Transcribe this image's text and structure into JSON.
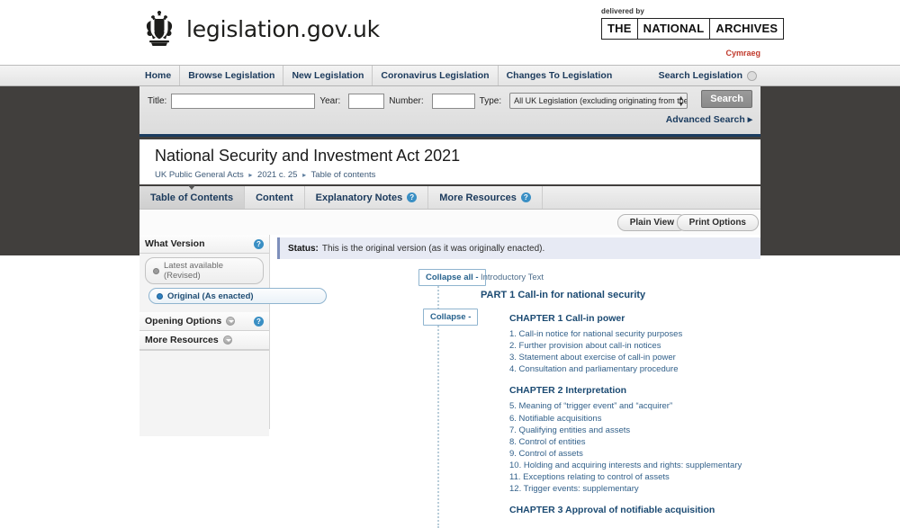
{
  "masthead": {
    "brand": "legislation.gov.uk",
    "delivered_by": "delivered by",
    "archives": [
      "THE",
      "NATIONAL",
      "ARCHIVES"
    ],
    "language_link": "Cymraeg"
  },
  "nav": {
    "items": [
      "Home",
      "Browse Legislation",
      "New Legislation",
      "Coronavirus Legislation",
      "Changes To Legislation"
    ],
    "search_link": "Search Legislation"
  },
  "search": {
    "title_label": "Title:",
    "title_value": "",
    "year_label": "Year:",
    "year_value": "",
    "number_label": "Number:",
    "number_value": "",
    "type_label": "Type:",
    "type_selected": "All UK Legislation (excluding originating from the",
    "search_button": "Search",
    "advanced_search": "Advanced Search ▸"
  },
  "page": {
    "title": "National Security and Investment Act 2021",
    "breadcrumb": [
      "UK Public General Acts",
      "2021 c. 25",
      "Table of contents"
    ]
  },
  "tabs": [
    {
      "label": "Table of Contents",
      "help": false,
      "active": true
    },
    {
      "label": "Content",
      "help": false,
      "active": false
    },
    {
      "label": "Explanatory Notes",
      "help": true,
      "active": false
    },
    {
      "label": "More Resources",
      "help": true,
      "active": false
    }
  ],
  "toolbar": {
    "plain_view": "Plain View",
    "print_options": "Print Options"
  },
  "sidebar": {
    "what_version": {
      "heading": "What Version",
      "options": [
        {
          "label": "Latest available (Revised)",
          "selected": false
        },
        {
          "label": "Original (As enacted)",
          "selected": true
        }
      ]
    },
    "opening_options": "Opening Options",
    "more_resources": "More Resources"
  },
  "status": {
    "label": "Status:",
    "text": "This is the original version (as it was originally enacted)."
  },
  "toc": {
    "collapse_all": "Collapse all -",
    "collapse": "Collapse -",
    "intro": "Introductory Text",
    "part": "PART 1 Call-in for national security",
    "chapters": [
      {
        "heading": "CHAPTER 1 Call-in power",
        "items": [
          "1. Call-in notice for national security purposes",
          "2. Further provision about call-in notices",
          "3. Statement about exercise of call-in power",
          "4. Consultation and parliamentary procedure"
        ]
      },
      {
        "heading": "CHAPTER 2 Interpretation",
        "items": [
          "5. Meaning of “trigger event” and “acquirer”",
          "6. Notifiable acquisitions",
          "7. Qualifying entities and assets",
          "8. Control of entities",
          "9. Control of assets",
          "10. Holding and acquiring interests and rights: supplementary",
          "11. Exceptions relating to control of assets",
          "12. Trigger events: supplementary"
        ]
      },
      {
        "heading": "CHAPTER 3 Approval of notifiable acquisition",
        "items": []
      }
    ]
  },
  "colors": {
    "backdrop": "#413f3d",
    "link_blue": "#1b3a5c",
    "accent_blue": "#3a8fc4",
    "status_bg": "#e7eaf4",
    "cymraeg_red": "#c0392b"
  }
}
